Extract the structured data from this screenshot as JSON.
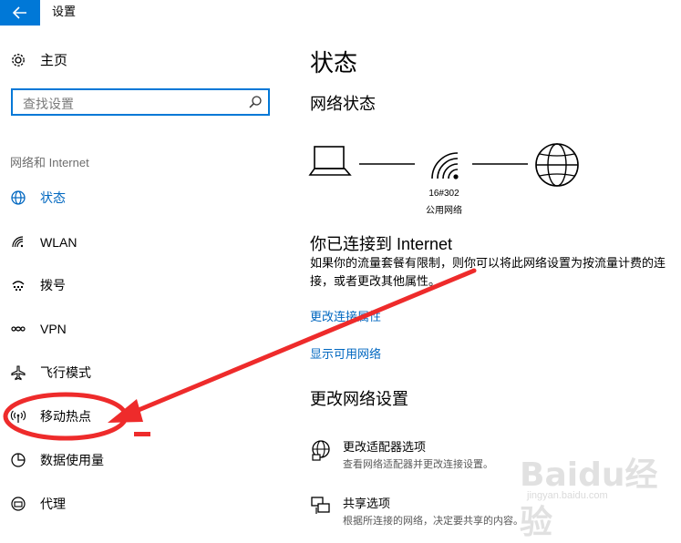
{
  "window": {
    "title": "设置"
  },
  "sidebar": {
    "home_label": "主页",
    "search_placeholder": "查找设置",
    "group_label": "网络和 Internet",
    "items": [
      {
        "label": "状态",
        "icon": "globe-icon",
        "active": true
      },
      {
        "label": "WLAN",
        "icon": "wifi-icon",
        "active": false
      },
      {
        "label": "拨号",
        "icon": "dialup-icon",
        "active": false
      },
      {
        "label": "VPN",
        "icon": "vpn-icon",
        "active": false
      },
      {
        "label": "飞行模式",
        "icon": "airplane-icon",
        "active": false
      },
      {
        "label": "移动热点",
        "icon": "hotspot-icon",
        "active": false
      },
      {
        "label": "数据使用量",
        "icon": "data-usage-icon",
        "active": false
      },
      {
        "label": "代理",
        "icon": "proxy-icon",
        "active": false
      }
    ]
  },
  "main": {
    "page_title": "状态",
    "network_status_heading": "网络状态",
    "network": {
      "name": "16#302",
      "type": "公用网络"
    },
    "connected_title": "你已连接到 Internet",
    "connected_desc": "如果你的流量套餐有限制，则你可以将此网络设置为按流量计费的连接，或者更改其他属性。",
    "links": {
      "change_properties": "更改连接属性",
      "show_networks": "显示可用网络"
    },
    "change_settings_heading": "更改网络设置",
    "options": [
      {
        "title": "更改适配器选项",
        "subtitle": "查看网络适配器并更改连接设置。",
        "icon": "adapter-icon"
      },
      {
        "title": "共享选项",
        "subtitle": "根据所连接的网络，决定要共享的内容。",
        "icon": "sharing-icon"
      }
    ]
  },
  "annotation": {
    "color": "#ee2b2b"
  },
  "watermark": {
    "brand": "Baidu经验",
    "url": "jingyan.baidu.com"
  },
  "colors": {
    "accent": "#0078d7",
    "link": "#0067c0"
  }
}
